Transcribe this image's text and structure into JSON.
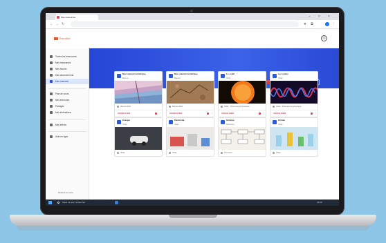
{
  "browser": {
    "tab_title": "Mes ressources",
    "url": "",
    "window_controls": [
      "–",
      "□",
      "×"
    ],
    "nav": [
      "←",
      "→",
      "↻"
    ],
    "toolbar_icons": [
      "★",
      "⧉",
      "⋮"
    ]
  },
  "app": {
    "name": "Éducation",
    "avatar_symbol": "◎"
  },
  "sidebar": {
    "items": [
      {
        "label": "Toutes les ressources",
        "active": false
      },
      {
        "label": "Mes ressources",
        "active": false
      },
      {
        "label": "Mes favoris",
        "active": false
      },
      {
        "label": "Mes abonnements",
        "active": false
      },
      {
        "label": "Mes manuels",
        "active": true
      },
      {
        "label": "Plan de cours",
        "active": false
      },
      {
        "label": "Mes exercices",
        "active": false
      },
      {
        "label": "Partagés",
        "active": false
      },
      {
        "label": "Mes évaluations",
        "active": false
      },
      {
        "label": "Mes élèves",
        "active": false
      },
      {
        "label": "Aide en ligne",
        "active": false
      }
    ],
    "footer": "Réduire le menu"
  },
  "toolbar": {
    "sort_label": "Date de création"
  },
  "colors": {
    "banner": "#2d50dc",
    "accent_red": "#e03a4e",
    "active_bg": "#dbe6fb"
  },
  "cards": [
    {
      "title": "Mon manuel numérique",
      "subtitle": "Manuel",
      "meta": "Manuel 2023",
      "button": "CONSULTER",
      "image": "geology"
    },
    {
      "title": "Mon manuel numérique",
      "subtitle": "Manuel",
      "meta": "Manuel 2023",
      "button": "CONSULTER",
      "image": "rock"
    },
    {
      "title": "Le soleil",
      "subtitle": "Vidéo",
      "meta": "Vidéo · Phénomènes physiques",
      "button": "VISUALISER",
      "image": "sun"
    },
    {
      "title": "Les ondes",
      "subtitle": "Vidéo",
      "meta": "Vidéo · Phénomènes physiques",
      "button": "VISUALISER",
      "image": "waves"
    },
    {
      "title": "Énergie",
      "subtitle": "Vidéo",
      "meta": "Vidéo",
      "button": "",
      "image": "car"
    },
    {
      "title": "Électricité",
      "subtitle": "Vidéo",
      "meta": "Vidéo",
      "button": "",
      "image": "lab"
    },
    {
      "title": "Schéma",
      "subtitle": "Document",
      "meta": "Document",
      "button": "",
      "image": "chart"
    },
    {
      "title": "Chimie",
      "subtitle": "Vidéo",
      "meta": "Vidéo",
      "button": "",
      "image": "chem"
    }
  ],
  "taskbar": {
    "search_placeholder": "Taper ici pour rechercher",
    "time": "10:00"
  }
}
